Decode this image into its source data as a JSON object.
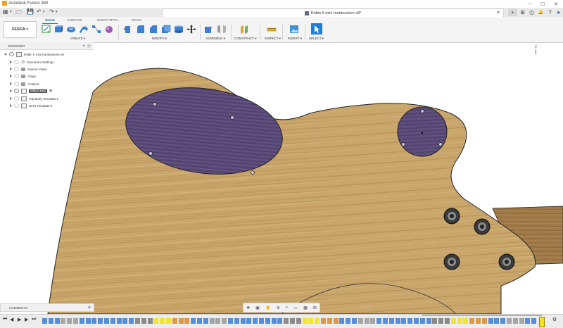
{
  "window": {
    "app_title": "Autodesk Fusion 360",
    "controls": [
      "–",
      "☐",
      "✕"
    ]
  },
  "tabbar": {
    "document_tab": "Robin II mini humbuckers v8*",
    "close": "✕",
    "new_tab": "+",
    "right_buttons": [
      "⊞",
      "◷",
      "🔔",
      "?",
      "●"
    ]
  },
  "quick_access": [
    "▦",
    "▾",
    "🗁",
    "💾",
    "↶",
    "▾",
    "↷",
    "▾"
  ],
  "ribbon": {
    "workspace": "DESIGN ▾",
    "tabs": [
      "SOLID",
      "SURFACE",
      "SHEET METAL",
      "TOOLS"
    ],
    "active_tab": "SOLID",
    "groups": [
      {
        "label": "CREATE ▾"
      },
      {
        "label": "MODIFY ▾"
      },
      {
        "label": "ASSEMBLE ▾"
      },
      {
        "label": "CONSTRUCT ▾"
      },
      {
        "label": "INSPECT ▾"
      },
      {
        "label": "INSERT ▾"
      },
      {
        "label": "SELECT ▾"
      }
    ]
  },
  "browser": {
    "title": "BROWSER",
    "items": [
      {
        "label": "Robin II mini humbuckers v8",
        "expanded": true,
        "highlight": false
      },
      {
        "label": "Document Settings",
        "highlight": false
      },
      {
        "label": "Named Views",
        "highlight": false
      },
      {
        "label": "Origin",
        "highlight": false
      },
      {
        "label": "Analysis",
        "highlight": false
      },
      {
        "label": "Offset 4/24",
        "highlight": true
      },
      {
        "label": "Top Body Template:1",
        "highlight": false
      },
      {
        "label": "Neck Template:1",
        "highlight": false
      }
    ]
  },
  "viewcube": {
    "face": "MIDDLE",
    "axis_label": "Z"
  },
  "comments": {
    "title": "COMMENTS"
  },
  "colors": {
    "wood_light": "#c9a66b",
    "wood_dark": "#a98248",
    "pocket": "#5a4a78",
    "accent": "#1a73c9",
    "playhead": "#f2e21a"
  }
}
